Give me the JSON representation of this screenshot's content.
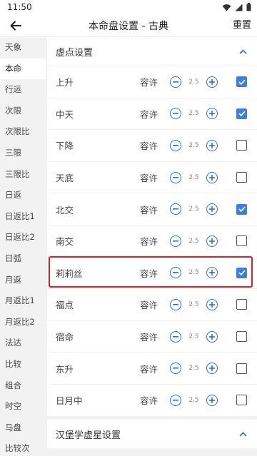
{
  "status": {
    "time": "11:50"
  },
  "header": {
    "title": "本命盘设置 - 古典",
    "reset_label": "重置"
  },
  "sidebar": {
    "active_index": 1,
    "items": [
      "天象",
      "本命",
      "行运",
      "次限",
      "次限比",
      "三限",
      "三限比",
      "日返",
      "日返比1",
      "日返比2",
      "日弧",
      "月返",
      "月返比1",
      "月返比2",
      "法达",
      "比较",
      "组合",
      "时空",
      "马盘",
      "比较次"
    ]
  },
  "section1": {
    "title": "虚点设置",
    "tolerance_label": "容许",
    "rows": [
      {
        "name": "上升",
        "value": "2.5",
        "checked": true
      },
      {
        "name": "中天",
        "value": "2.5",
        "checked": true
      },
      {
        "name": "下降",
        "value": "2.5",
        "checked": false
      },
      {
        "name": "天底",
        "value": "2.5",
        "checked": false
      },
      {
        "name": "北交",
        "value": "2.5",
        "checked": true
      },
      {
        "name": "南交",
        "value": "2.5",
        "checked": false
      },
      {
        "name": "莉莉丝",
        "value": "2.5",
        "checked": true
      },
      {
        "name": "福点",
        "value": "2.5",
        "checked": false
      },
      {
        "name": "宿命",
        "value": "2.5",
        "checked": false
      },
      {
        "name": "东升",
        "value": "2.5",
        "checked": false
      },
      {
        "name": "日月中",
        "value": "2.5",
        "checked": false
      }
    ]
  },
  "section2": {
    "title": "汉堡学虚星设置"
  },
  "colors": {
    "accent": "#3d7fe0",
    "highlight": "#e02020"
  },
  "icons": {
    "back": "arrow-left-icon",
    "collapse": "chevron-up-icon",
    "minus": "minus-circle-icon",
    "plus": "plus-circle-icon"
  }
}
